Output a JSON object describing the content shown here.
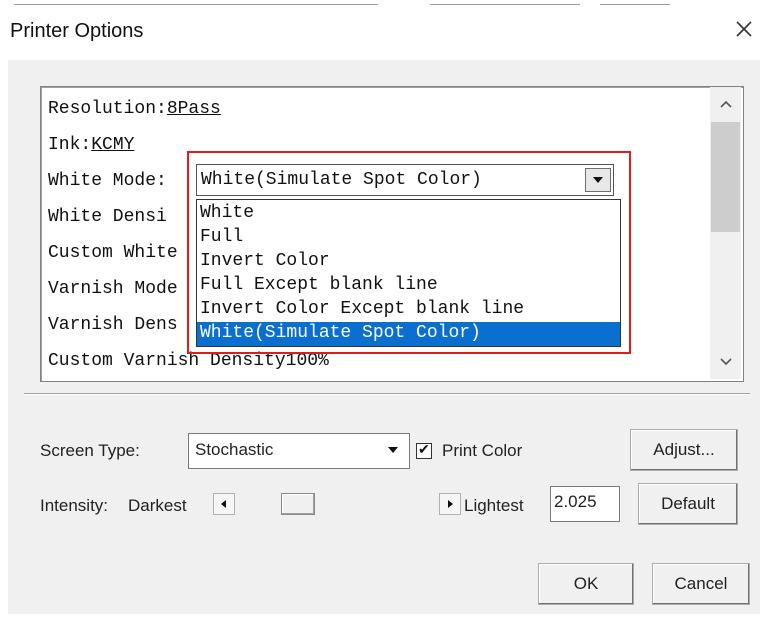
{
  "window": {
    "title": "Printer Options",
    "close_icon": "close-icon"
  },
  "properties": {
    "rows": [
      {
        "label": "Resolution:",
        "value": "8Pass"
      },
      {
        "label": "Ink:",
        "value": "KCMY"
      },
      {
        "label": "White Mode:",
        "value": ""
      },
      {
        "label": "White Densi",
        "value": ""
      },
      {
        "label": "Custom White",
        "value": ""
      },
      {
        "label": "Varnish Mode",
        "value": ""
      },
      {
        "label": "Varnish Dens",
        "value": ""
      },
      {
        "label": "Custom Varnish Density",
        "value": "100%"
      }
    ]
  },
  "white_mode": {
    "selected": "White(Simulate Spot Color)",
    "options": [
      "White",
      "Full",
      "Invert Color",
      "Full Except blank line",
      "Invert Color Except blank line",
      "White(Simulate Spot Color)"
    ],
    "highlight_color": "#0a6fcf",
    "annotation_color": "#e01b1b"
  },
  "screen": {
    "label": "Screen Type:",
    "value": "Stochastic",
    "print_color_label": "Print Color",
    "print_color_checked": "✔",
    "adjust_label": "Adjust..."
  },
  "intensity": {
    "label": "Intensity:",
    "darkest": "Darkest",
    "lightest": "Lightest",
    "value": "2.025",
    "default_label": "Default"
  },
  "footer": {
    "ok_label": "OK",
    "cancel_label": "Cancel"
  }
}
